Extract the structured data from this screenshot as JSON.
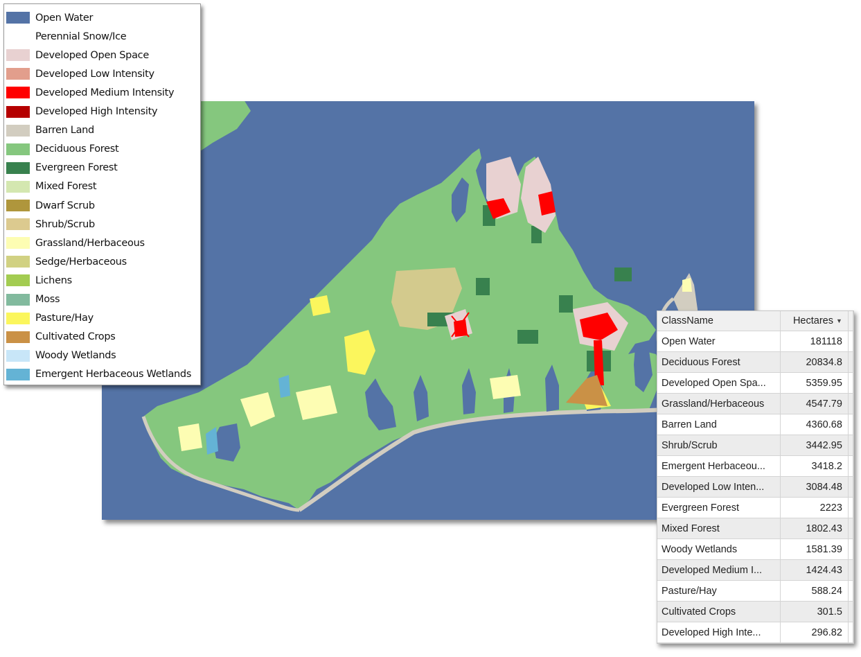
{
  "legend": {
    "items": [
      {
        "label": "Open Water",
        "color": "#5473a6"
      },
      {
        "label": "Perennial Snow/Ice",
        "color": "#ffffff"
      },
      {
        "label": "Developed Open Space",
        "color": "#e8d1d1"
      },
      {
        "label": "Developed Low Intensity",
        "color": "#e29e8c"
      },
      {
        "label": "Developed Medium Intensity",
        "color": "#ff0000"
      },
      {
        "label": "Developed High Intensity",
        "color": "#b50000"
      },
      {
        "label": "Barren Land",
        "color": "#d2cdc0"
      },
      {
        "label": "Deciduous Forest",
        "color": "#85c77e"
      },
      {
        "label": "Evergreen Forest",
        "color": "#38814e"
      },
      {
        "label": "Mixed Forest",
        "color": "#d4e7b0"
      },
      {
        "label": "Dwarf Scrub",
        "color": "#af963c"
      },
      {
        "label": "Shrub/Scrub",
        "color": "#dcca8f"
      },
      {
        "label": "Grassland/Herbaceous",
        "color": "#fdfdb3"
      },
      {
        "label": "Sedge/Herbaceous",
        "color": "#d1d182"
      },
      {
        "label": "Lichens",
        "color": "#a3cc51"
      },
      {
        "label": "Moss",
        "color": "#82ba9e"
      },
      {
        "label": "Pasture/Hay",
        "color": "#fbf65d"
      },
      {
        "label": "Cultivated Crops",
        "color": "#ca9146"
      },
      {
        "label": "Woody Wetlands",
        "color": "#c8e6f8"
      },
      {
        "label": "Emergent Herbaceous Wetlands",
        "color": "#64b3d5"
      }
    ]
  },
  "table": {
    "columns": [
      {
        "label": "ClassName"
      },
      {
        "label": "Hectares",
        "sort_icon": "sort-descending-caret-icon",
        "sort_glyph": "▼"
      }
    ],
    "rows": [
      {
        "name": "Open Water",
        "hectares": "181118"
      },
      {
        "name": "Deciduous Forest",
        "hectares": "20834.8"
      },
      {
        "name": "Developed Open Spa...",
        "hectares": "5359.95"
      },
      {
        "name": "Grassland/Herbaceous",
        "hectares": "4547.79"
      },
      {
        "name": "Barren Land",
        "hectares": "4360.68"
      },
      {
        "name": "Shrub/Scrub",
        "hectares": "3442.95"
      },
      {
        "name": "Emergent Herbaceou...",
        "hectares": "3418.2"
      },
      {
        "name": "Developed Low Inten...",
        "hectares": "3084.48"
      },
      {
        "name": "Evergreen Forest",
        "hectares": "2223"
      },
      {
        "name": "Mixed Forest",
        "hectares": "1802.43"
      },
      {
        "name": "Woody Wetlands",
        "hectares": "1581.39"
      },
      {
        "name": "Developed Medium I...",
        "hectares": "1424.43"
      },
      {
        "name": "Pasture/Hay",
        "hectares": "588.24"
      },
      {
        "name": "Cultivated Crops",
        "hectares": "301.5"
      },
      {
        "name": "Developed High Inte...",
        "hectares": "296.82"
      }
    ]
  },
  "map": {
    "water_color": "#5473a6",
    "land_color": "#85c77e",
    "beach_color": "#d2cdc0",
    "developed_color": "#ff0000",
    "developed_open_color": "#e8d1d1",
    "evergreen_color": "#38814e",
    "shrub_color": "#dcca8f",
    "grass_color": "#fdfdb3",
    "pasture_color": "#fbf65d",
    "crops_color": "#ca9146",
    "wetland_color": "#64b3d5"
  }
}
